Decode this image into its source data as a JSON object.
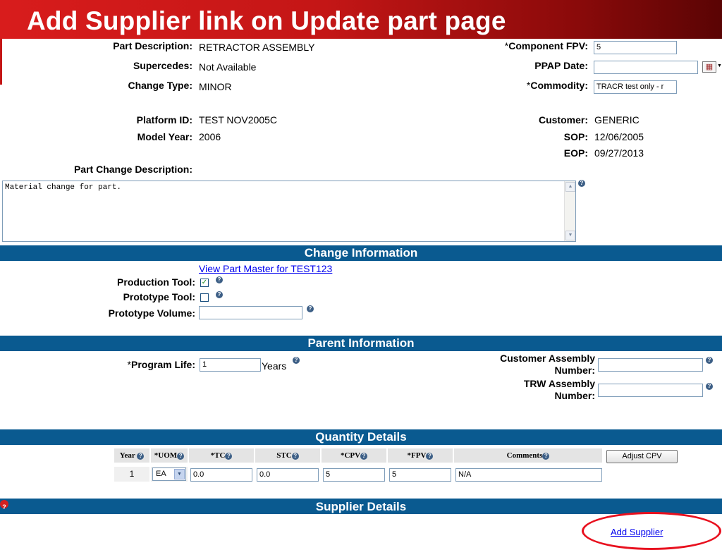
{
  "title": "Add Supplier link on Update part page",
  "part": {
    "part_description_label": "Part Description:",
    "part_description": "RETRACTOR ASSEMBLY",
    "supercedes_label": "Supercedes:",
    "supercedes": "Not Available",
    "change_type_label": "Change Type:",
    "change_type": "MINOR",
    "platform_id_label": "Platform ID:",
    "platform_id": "TEST NOV2005C",
    "model_year_label": "Model Year:",
    "model_year": "2006",
    "component_fpv_label": "Component FPV:",
    "component_fpv": "5",
    "ppap_date_label": "PPAP Date:",
    "ppap_date": "",
    "commodity_label": "Commodity:",
    "commodity": "TRACR test only - r",
    "customer_label": "Customer:",
    "customer": "GENERIC",
    "sop_label": "SOP:",
    "sop": "12/06/2005",
    "eop_label": "EOP:",
    "eop": "09/27/2013",
    "change_description_label": "Part Change Description:",
    "change_description": "Material change for part.",
    "required_marker": "*"
  },
  "change_information": {
    "header": "Change Information",
    "view_part_master_link": "View Part Master for TEST123",
    "production_tool_label": "Production Tool:",
    "production_tool_checked": "✓",
    "prototype_tool_label": "Prototype Tool:",
    "prototype_volume_label": "Prototype Volume:",
    "prototype_volume": ""
  },
  "parent_information": {
    "header": "Parent Information",
    "program_life_label": "Program Life:",
    "program_life": "1",
    "years_label": "Years",
    "customer_assembly_label_1": "Customer Assembly",
    "customer_assembly_label_2": "Number:",
    "customer_assembly": "",
    "trw_assembly_label_1": "TRW Assembly",
    "trw_assembly_label_2": "Number:",
    "trw_assembly": ""
  },
  "quantity_details": {
    "header": "Quantity Details",
    "columns": [
      "Year",
      "*UOM",
      "*TC",
      "STC",
      "*CPV",
      "*FPV",
      "Comments"
    ],
    "row": {
      "year": "1",
      "uom": "EA",
      "tc": "0.0",
      "stc": "0.0",
      "cpv": "5",
      "fpv": "5",
      "comments": "N/A"
    },
    "adjust_cpv_button": "Adjust CPV"
  },
  "supplier_details": {
    "header": "Supplier Details",
    "add_supplier_link": "Add Supplier"
  },
  "icons": {
    "help": "?",
    "chevron_down": "▼",
    "scroll_up": "▲",
    "scroll_down": "▼",
    "calendar": "▦"
  },
  "colors": {
    "title_red": "#d81c1c",
    "section_blue": "#0a5a90",
    "highlight_red": "#e8101e",
    "link_blue": "#0000ee"
  }
}
